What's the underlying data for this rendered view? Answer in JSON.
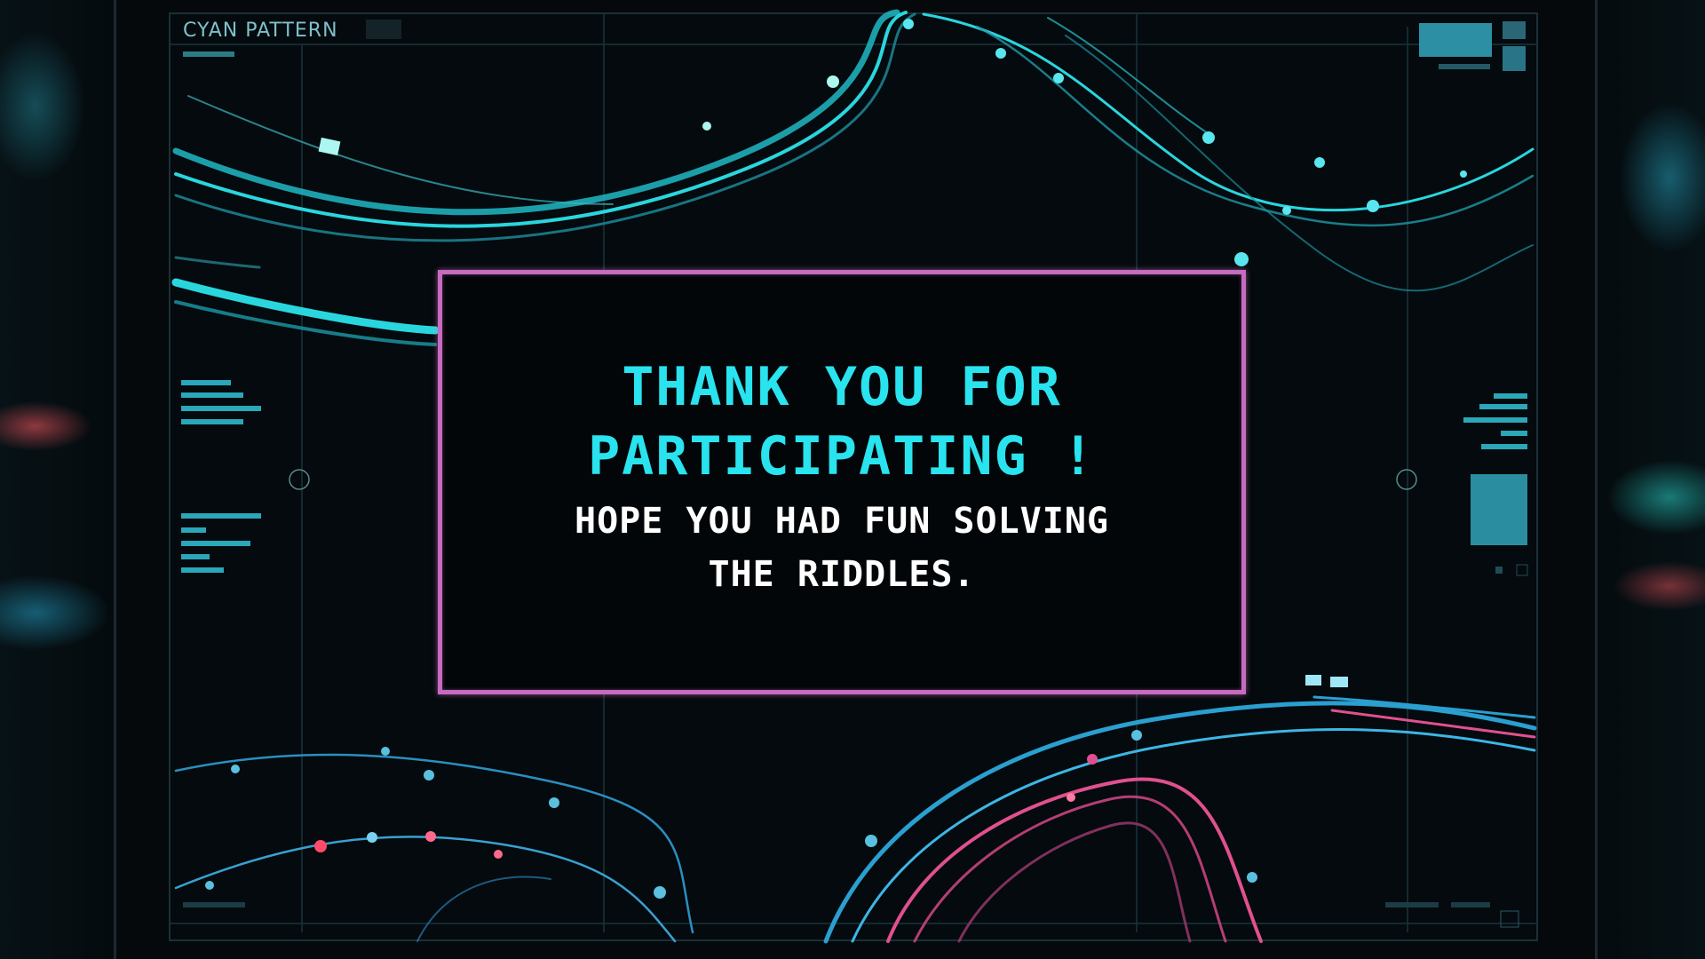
{
  "screen": {
    "title": "CYAN PATTERN"
  },
  "message": {
    "headline": "THANK YOU FOR PARTICIPATING !",
    "subtext": "HOPE YOU HAD FUN SOLVING THE RIDDLES."
  },
  "colors": {
    "accent_cyan": "#29e3ee",
    "panel_border": "#c66bbf",
    "text_white": "#ffffff",
    "background": "#03080b"
  }
}
